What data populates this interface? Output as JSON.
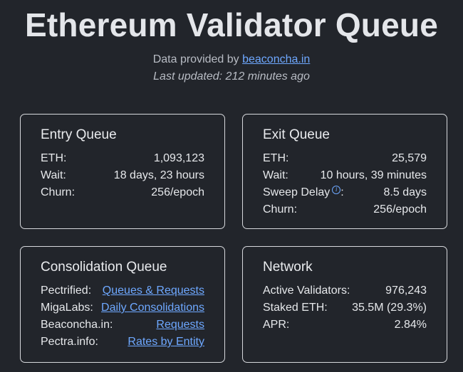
{
  "header": {
    "title": "Ethereum Validator Queue",
    "data_prefix": "Data provided by ",
    "data_link": "beaconcha.in",
    "updated": "Last updated: 212 minutes ago"
  },
  "entry": {
    "title": "Entry Queue",
    "rows": [
      {
        "label": "ETH:",
        "value": "1,093,123"
      },
      {
        "label": "Wait:",
        "value": "18 days, 23 hours"
      },
      {
        "label": "Churn:",
        "value": "256/epoch"
      }
    ]
  },
  "exit": {
    "title": "Exit Queue",
    "rows": [
      {
        "label": "ETH:",
        "value": "25,579"
      },
      {
        "label": "Wait:",
        "value": "10 hours, 39 minutes"
      },
      {
        "label": "Sweep Delay",
        "suffix": ":",
        "value": "8.5 days"
      },
      {
        "label": "Churn:",
        "value": "256/epoch"
      }
    ]
  },
  "consolidation": {
    "title": "Consolidation Queue",
    "rows": [
      {
        "label": "Pectrified:",
        "value": "Queues & Requests"
      },
      {
        "label": "MigaLabs:",
        "value": "Daily Consolidations"
      },
      {
        "label": "Beaconcha.in:",
        "value": "Requests"
      },
      {
        "label": "Pectra.info:",
        "value": "Rates by Entity"
      }
    ]
  },
  "network": {
    "title": "Network",
    "rows": [
      {
        "label": "Active Validators:",
        "value": "976,243"
      },
      {
        "label": "Staked ETH:",
        "value": "35.5M (29.3%)"
      },
      {
        "label": "APR:",
        "value": "2.84%"
      }
    ]
  },
  "icons": {
    "info": "info-circle-icon"
  },
  "colors": {
    "background": "#22252b",
    "link": "#6ea8ff",
    "border": "#d7d9dd"
  }
}
